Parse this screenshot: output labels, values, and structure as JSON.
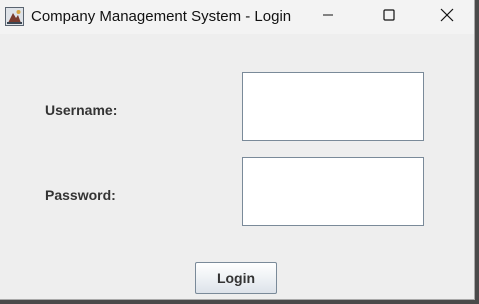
{
  "window": {
    "title": "Company Management System - Login",
    "controls": {
      "minimize": "minimize-icon",
      "maximize": "maximize-icon",
      "close": "close-icon"
    }
  },
  "form": {
    "username_label": "Username:",
    "password_label": "Password:",
    "username_value": "",
    "password_value": "",
    "login_label": "Login"
  },
  "colors": {
    "window_bg": "#eeeeee",
    "titlebar_bg": "#f3f3f3",
    "field_border": "#7a8a99",
    "label_text": "#333333"
  }
}
